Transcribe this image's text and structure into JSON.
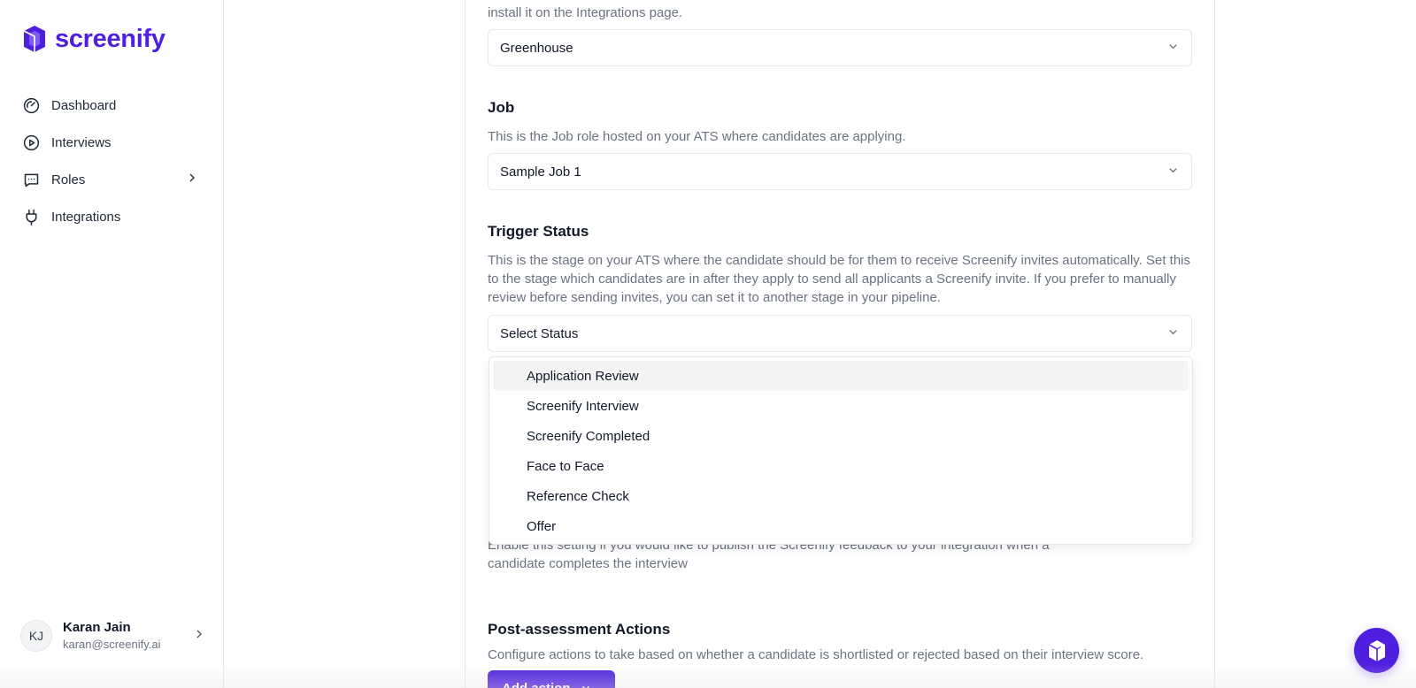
{
  "brand": {
    "name": "screenify",
    "color": "#4f1fe0"
  },
  "sidebar": {
    "items": [
      {
        "label": "Dashboard",
        "icon": "gauge-icon"
      },
      {
        "label": "Interviews",
        "icon": "play-circle-icon"
      },
      {
        "label": "Roles",
        "icon": "message-square-icon",
        "has_submenu": true
      },
      {
        "label": "Integrations",
        "icon": "plug-icon"
      }
    ],
    "user": {
      "initials": "KJ",
      "name": "Karan Jain",
      "email": "karan@screenify.ai"
    }
  },
  "form": {
    "integration": {
      "help_tail": "install it on the Integrations page.",
      "value": "Greenhouse"
    },
    "job": {
      "title": "Job",
      "help": "This is the Job role hosted on your ATS where candidates are applying.",
      "value": "Sample Job 1"
    },
    "trigger_status": {
      "title": "Trigger Status",
      "help": "This is the stage on your ATS where the candidate should be for them to receive Screenify invites automatically. Set this to the stage which candidates are in after they apply to send all applicants a Screenify invite. If you prefer to manually review before sending invites, you can set it to another stage in your pipeline.",
      "placeholder": "Select Status",
      "options": [
        "Application Review",
        "Screenify Interview",
        "Screenify Completed",
        "Face to Face",
        "Reference Check",
        "Offer"
      ],
      "highlighted_option": "Application Review"
    },
    "publish_feedback": {
      "help_line1": "Enable this setting if you would like to publish the Screenify feedback to your integration when a",
      "help_line2": "candidate completes the interview"
    },
    "post_assessment": {
      "title": "Post-assessment Actions",
      "help": "Configure actions to take based on whether a candidate is shortlisted or rejected based on their interview score.",
      "button": "Add action"
    }
  }
}
